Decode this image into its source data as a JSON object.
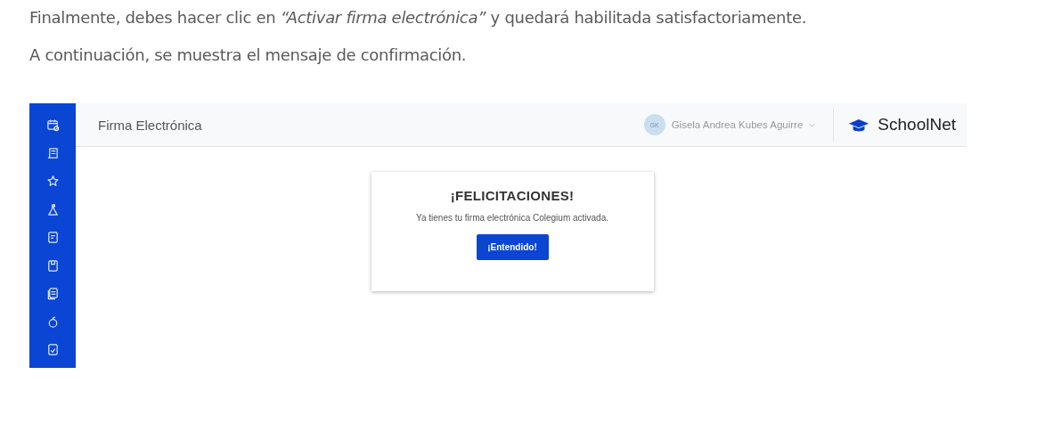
{
  "document": {
    "paragraphs": [
      "Finalmente, debes hacer clic en *“Activar firma electrónica”* y quedará habilitada satisfactoriamente.",
      "A continuación, se muestra el mensaje de confirmación."
    ]
  },
  "app": {
    "header": {
      "title": "Firma Electrónica",
      "user": {
        "initials": "GK",
        "name": "Gisela Andrea Kubes Aguirre"
      },
      "brand": "SchoolNet"
    },
    "dialog": {
      "title": "¡FELICITACIONES!",
      "message": "Ya tienes tu firma electrónica Colegium activada.",
      "button": "¡Entendido!"
    }
  }
}
